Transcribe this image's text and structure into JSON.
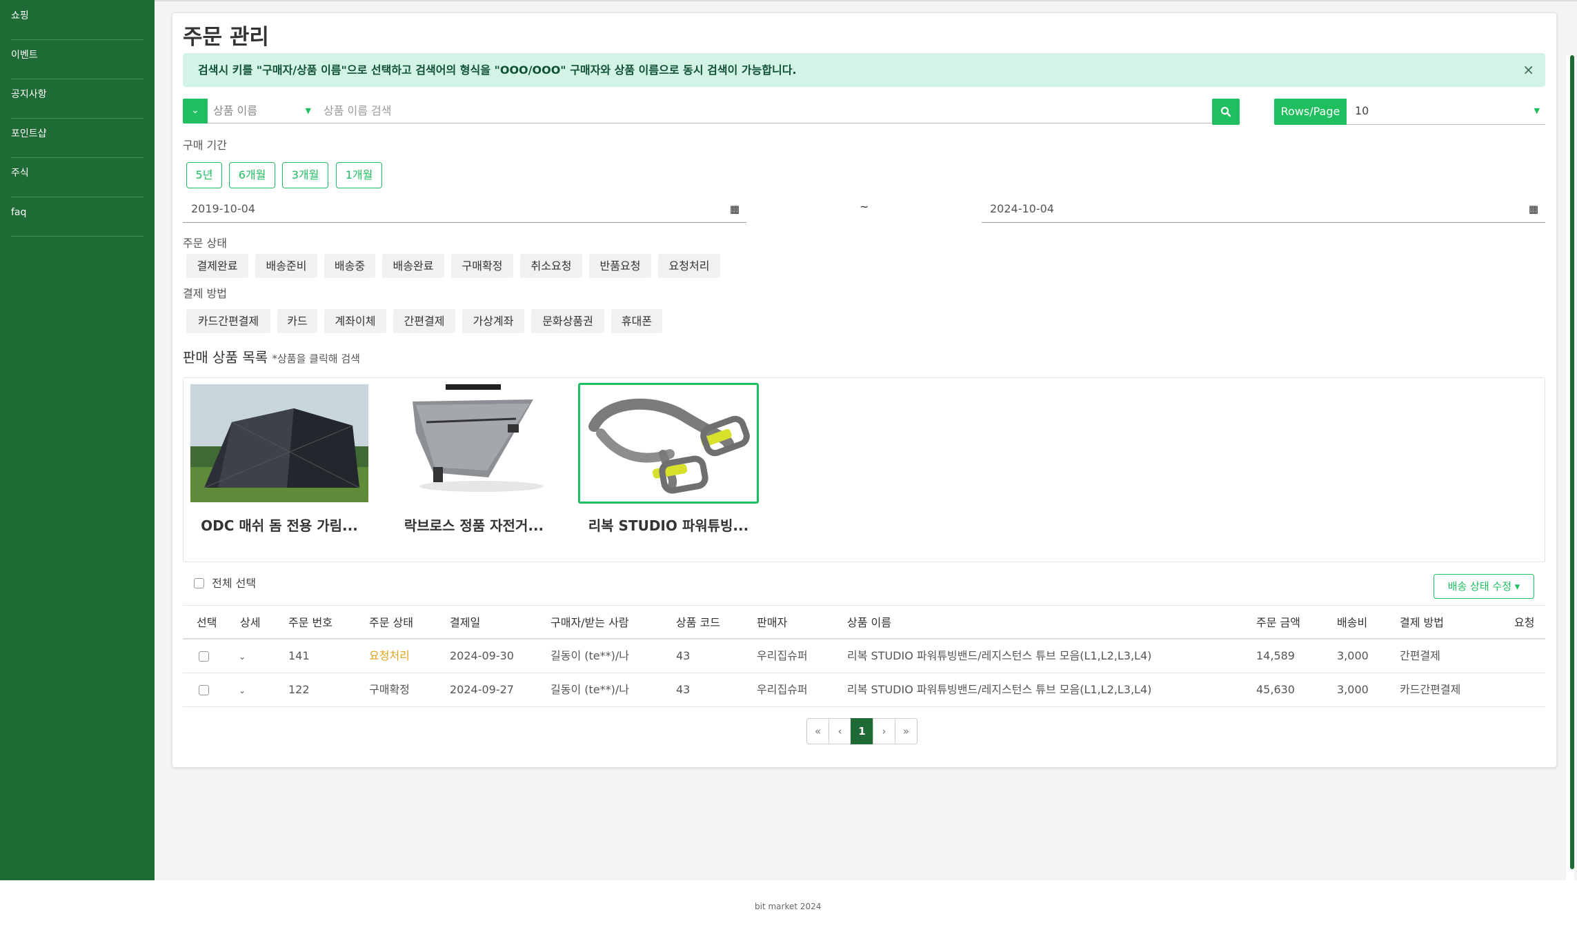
{
  "sidebar": {
    "items": [
      {
        "label": "쇼핑"
      },
      {
        "label": "이벤트"
      },
      {
        "label": "공지사항"
      },
      {
        "label": "포인트샵"
      },
      {
        "label": "주식"
      },
      {
        "label": "faq"
      }
    ]
  },
  "page": {
    "title": "주문 관리",
    "alert": "검색시 키를 \"구매자/상품 이름\"으로 선택하고 검색어의 형식을 \"OOO/OOO\" 구매자와 상품 이름으로 동시 검색이 가능합니다.",
    "alert_close": "×"
  },
  "search": {
    "key_value": "상품 이름",
    "placeholder": "상품 이름 검색",
    "rows_label": "Rows/Page",
    "rows_value": "10"
  },
  "period": {
    "label": "구매 기간",
    "buttons": [
      "5년",
      "6개월",
      "3개월",
      "1개월"
    ],
    "start_date": "2019-10-04",
    "end_date": "2024-10-04",
    "separator": "~"
  },
  "order_status": {
    "label": "주문 상태",
    "chips": [
      "결제완료",
      "배송준비",
      "배송중",
      "배송완료",
      "구매확정",
      "취소요청",
      "반품요청",
      "요청처리"
    ]
  },
  "payment": {
    "label": "결제 방법",
    "chips": [
      "카드간편결제",
      "카드",
      "계좌이체",
      "간편결제",
      "가상계좌",
      "문화상품권",
      "휴대폰"
    ]
  },
  "products": {
    "title": "판매 상품 목록",
    "hint": "*상품을 클릭해 검색",
    "items": [
      {
        "name": "ODC 매쉬 돔 전용 가림...",
        "image": "tent-image"
      },
      {
        "name": "락브로스 정품 자전거...",
        "image": "bike-bag-image"
      },
      {
        "name": "리복 STUDIO 파워튜빙...",
        "image": "resistance-tube-image",
        "selected": true
      }
    ]
  },
  "table": {
    "select_all": "전체 선택",
    "status_button": "배송 상태 수정 ▾",
    "headers": [
      "선택",
      "상세",
      "주문 번호",
      "주문 상태",
      "결제일",
      "구매자/받는 사람",
      "상품 코드",
      "판매자",
      "상품 이름",
      "주문 금액",
      "배송비",
      "결제 방법",
      "요청"
    ],
    "rows": [
      {
        "order_no": "141",
        "status": "요청처리",
        "date": "2024-09-30",
        "buyer": "길동이 (te**)/나",
        "code": "43",
        "seller": "우리집슈퍼",
        "product": "리복 STUDIO 파워튜빙밴드/레지스턴스 튜브 모음(L1,L2,L3,L4)",
        "amount": "14,589",
        "shipping": "3,000",
        "payment": "간편결제",
        "request": ""
      },
      {
        "order_no": "122",
        "status": "구매확정",
        "date": "2024-09-27",
        "buyer": "길동이 (te**)/나",
        "code": "43",
        "seller": "우리집슈퍼",
        "product": "리복 STUDIO 파워튜빙밴드/레지스턴스 튜브 모음(L1,L2,L3,L4)",
        "amount": "45,630",
        "shipping": "3,000",
        "payment": "카드간편결제",
        "request": ""
      }
    ]
  },
  "pagination": {
    "first": "«",
    "prev": "‹",
    "current": "1",
    "next": "›",
    "last": "»"
  },
  "footer": {
    "text": "bit market 2024"
  },
  "colors": {
    "sidebar": "#1f6b36",
    "accent": "#1fbf5f",
    "alert_bg": "#d3f3e6",
    "status_request": "#e0a31c"
  }
}
